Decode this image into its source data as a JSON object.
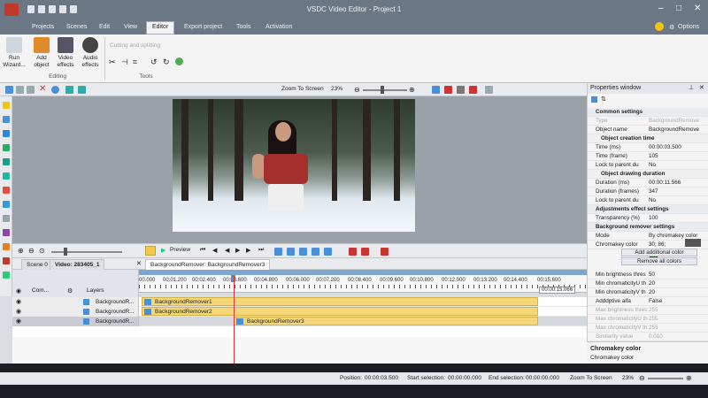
{
  "window": {
    "title": "VSDC Video Editor - Project 1",
    "options_label": "Options"
  },
  "menu": [
    "Projects",
    "Scenes",
    "Edit",
    "View",
    "Editor",
    "Export project",
    "Tools",
    "Activation"
  ],
  "ribbon": {
    "buttons": [
      {
        "label": "Run Wizard...",
        "icon": "wand-icon"
      },
      {
        "label": "Add object",
        "icon": "add-object-icon"
      },
      {
        "label": "Video effects",
        "icon": "video-effects-icon"
      },
      {
        "label": "Audio effects",
        "icon": "audio-effects-icon"
      }
    ],
    "cutting_label": "Cutting and splitting",
    "group_editing": "Editing",
    "group_tools": "Tools"
  },
  "toolbar": {
    "zoom_label": "Zoom To Screen",
    "zoom_value": "23%"
  },
  "timeline": {
    "preview_label": "Preview",
    "tabs": [
      "Scene 0",
      "Video: 283405_1",
      "BackgroundRemover: BackgroundRemover3"
    ],
    "head_labels": {
      "com": "Com...",
      "layers": "Layers"
    },
    "ticks": [
      "00.000",
      "00:01.200",
      "00:02.400",
      "00:03.600",
      "00:04.800",
      "00:06.000",
      "00:07.200",
      "00:08.400",
      "00:09.600",
      "00:10.800",
      "00:12.000",
      "00:13.200",
      "00:14.400",
      "00:15.600"
    ],
    "end_time": "00:00:15.066",
    "tracks": [
      {
        "name": "BackgroundR...",
        "clip": "BackgroundRemover1"
      },
      {
        "name": "BackgroundR...",
        "clip": "BackgroundRemover2"
      },
      {
        "name": "BackgroundR...",
        "clip": "BackgroundRemover3"
      }
    ]
  },
  "properties": {
    "title": "Properties window",
    "rows": [
      {
        "k": "Common settings",
        "v": "",
        "t": "sec"
      },
      {
        "k": "Type",
        "v": "BackgroundRemove",
        "t": "dim"
      },
      {
        "k": "Object name",
        "v": "BackgroundRemove",
        "t": ""
      },
      {
        "k": "Object creation time",
        "v": "",
        "t": "sub"
      },
      {
        "k": "Time (ms)",
        "v": "00:00:03.500",
        "t": ""
      },
      {
        "k": "Time (frame)",
        "v": "105",
        "t": ""
      },
      {
        "k": "Lock to parent du",
        "v": "No",
        "t": ""
      },
      {
        "k": "Object drawing duration",
        "v": "",
        "t": "sub"
      },
      {
        "k": "Duration (ms)",
        "v": "00:00:11.566",
        "t": ""
      },
      {
        "k": "Duration (frames)",
        "v": "347",
        "t": ""
      },
      {
        "k": "Lock to parent du",
        "v": "No",
        "t": ""
      },
      {
        "k": "Adjustments effect settings",
        "v": "",
        "t": "sec"
      },
      {
        "k": "Transparency (%)",
        "v": "100",
        "t": ""
      },
      {
        "k": "Background remover settings",
        "v": "",
        "t": "sec"
      },
      {
        "k": "Mode",
        "v": "By chromakey color",
        "t": ""
      },
      {
        "k": "Chromakey color",
        "v": "30; 86;",
        "t": ""
      }
    ],
    "btn_add": "Add additional color",
    "btn_remove": "Remove all colors",
    "rows2": [
      {
        "k": "Min brightness thres",
        "v": "50",
        "t": ""
      },
      {
        "k": "Min chromaticityU th",
        "v": "20",
        "t": ""
      },
      {
        "k": "Min chromaticityV th",
        "v": "20",
        "t": ""
      },
      {
        "k": "Adddptive alfa",
        "v": "False",
        "t": ""
      },
      {
        "k": "Max brightness thres",
        "v": "255",
        "t": "dim"
      },
      {
        "k": "Max chromaticityU th",
        "v": "255",
        "t": "dim"
      },
      {
        "k": "Max chromaticityV th",
        "v": "255",
        "t": "dim"
      },
      {
        "k": "Similarity value",
        "v": "0.010",
        "t": "dim"
      },
      {
        "k": "Blend value",
        "v": "0.000",
        "t": "dim"
      }
    ],
    "desc_title": "Chromakey color",
    "desc_text": "Chromakey color"
  },
  "status": {
    "position_label": "Position:",
    "position": "00:00:03.500",
    "start_label": "Start selection:",
    "start": "00:00:00.000",
    "end_label": "End selection:",
    "end": "00:00:00.000",
    "zoom_label": "Zoom To Screen",
    "zoom": "23%"
  }
}
